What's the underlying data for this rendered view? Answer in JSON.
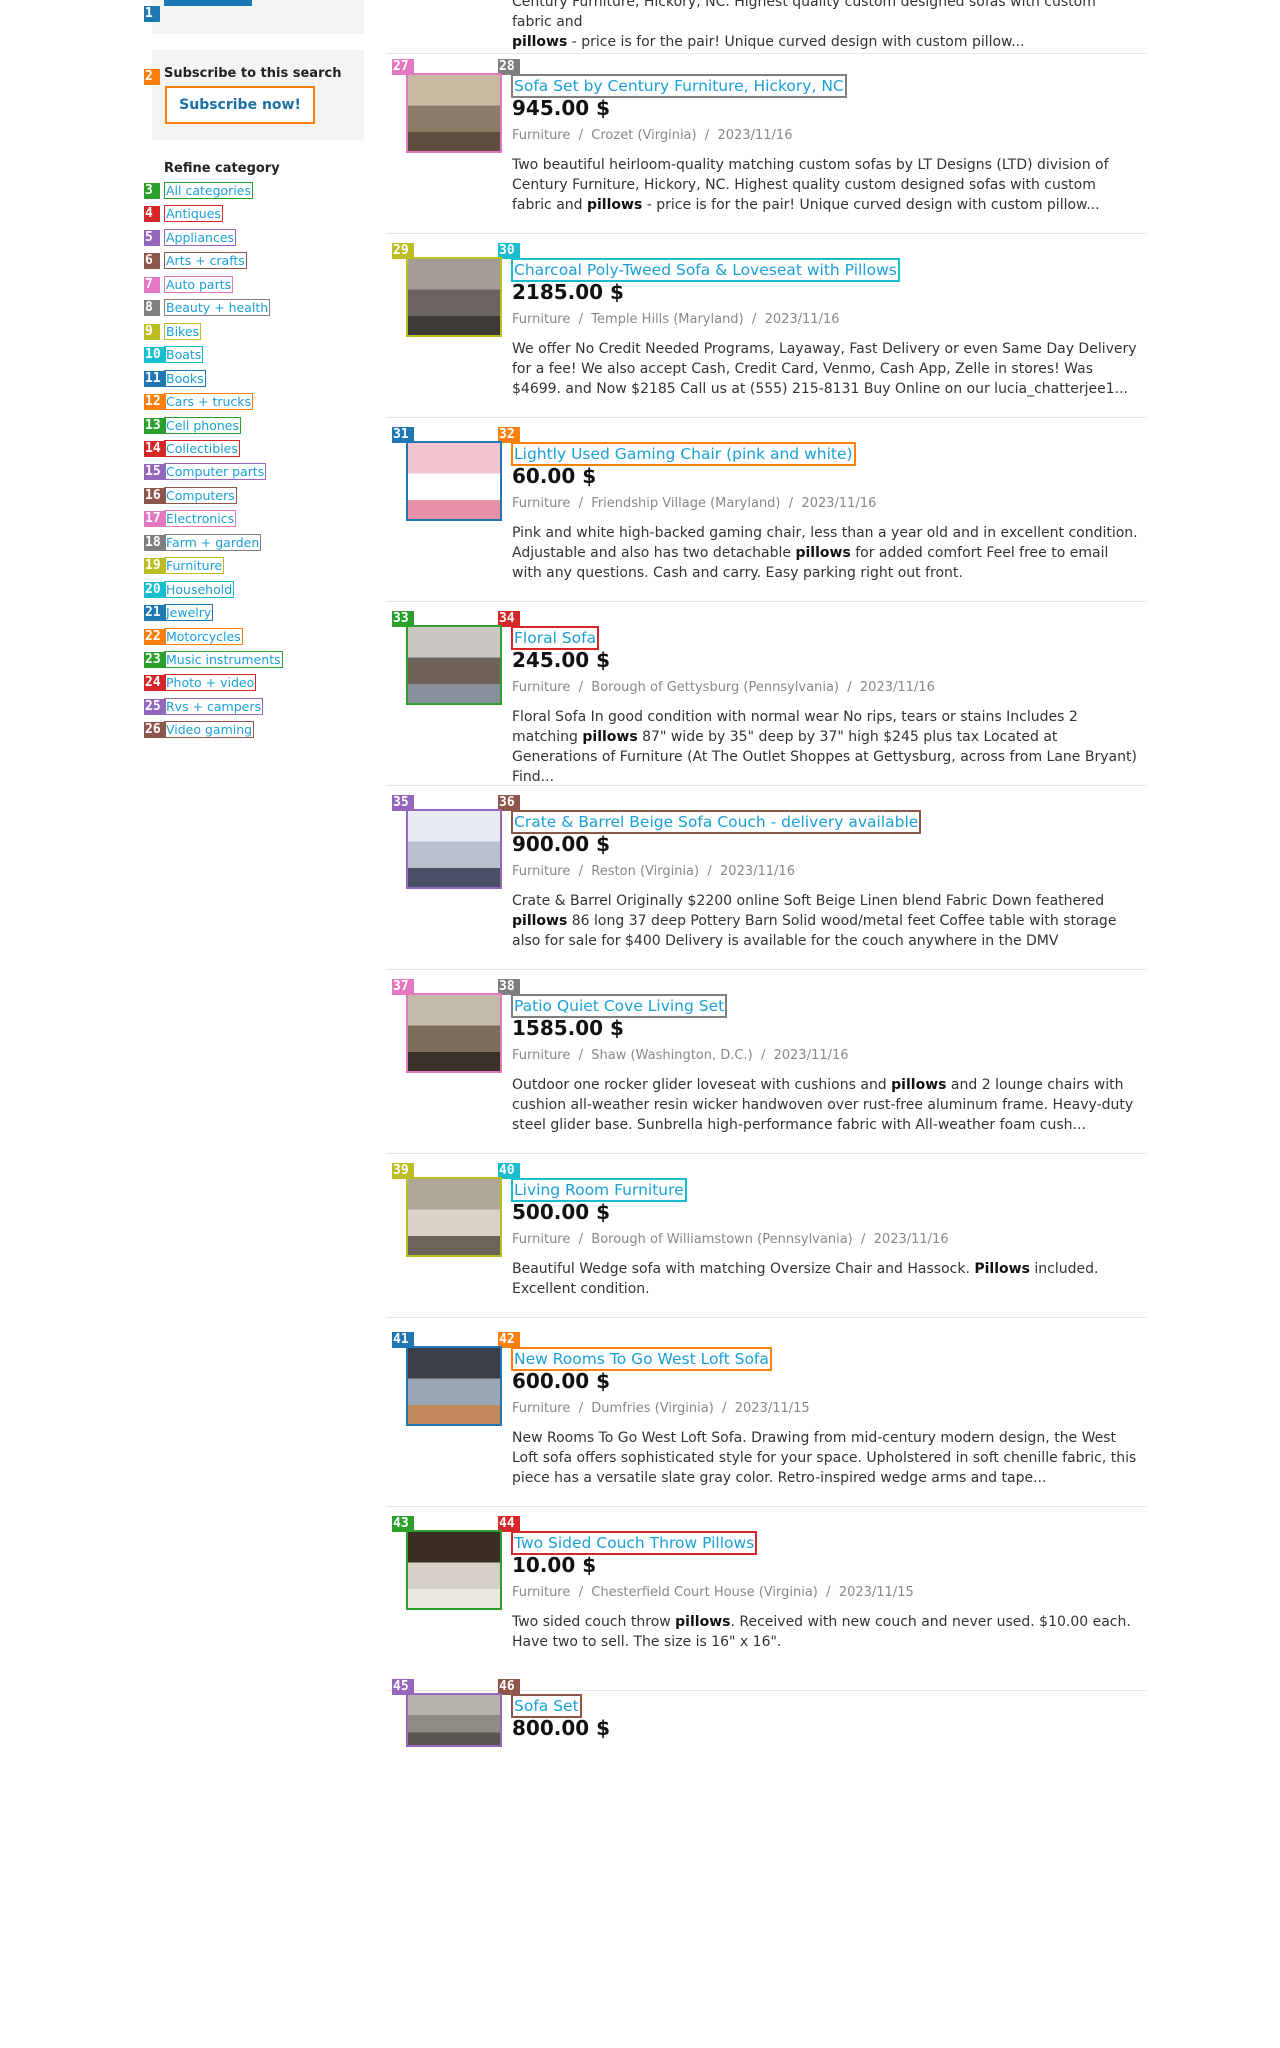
{
  "sidebar": {
    "subscribe_title": "Subscribe to this search",
    "subscribe_button": "Subscribe now!",
    "refine_title": "Refine category",
    "categories": [
      "All categories",
      "Antiques",
      "Appliances",
      "Arts + crafts",
      "Auto parts",
      "Beauty + health",
      "Bikes",
      "Boats",
      "Books",
      "Cars + trucks",
      "Cell phones",
      "Collectibles",
      "Computer parts",
      "Computers",
      "Electronics",
      "Farm + garden",
      "Furniture",
      "Household",
      "Jewelry",
      "Motorcycles",
      "Music instruments",
      "Photo + video",
      "Rvs + campers",
      "Video gaming"
    ]
  },
  "top_snippet": {
    "line1": "Century Furniture, Hickory, NC. Highest quality custom designed sofas with custom fabric and",
    "bold": "pillows",
    "line2": " - price is for the pair! Unique curved design with custom pillow..."
  },
  "listings": [
    {
      "title": "Sofa Set by Century Furniture, Hickory, NC",
      "price": "945.00 $",
      "category": "Furniture",
      "location": "Crozet (Virginia)",
      "date": "2023/11/16",
      "d1": "Two beautiful heirloom-quality matching custom sofas by LT Designs (LTD) division of Century Furniture, Hickory, NC. Highest quality custom designed sofas with custom fabric and ",
      "b": "pillows",
      "d2": " - price is for the pair! Unique curved design with custom pillow..."
    },
    {
      "title": "Charcoal Poly-Tweed Sofa & Loveseat with Pillows",
      "price": "2185.00 $",
      "category": "Furniture",
      "location": "Temple Hills (Maryland)",
      "date": "2023/11/16",
      "d1": "We offer No Credit Needed Programs, Layaway, Fast Delivery or even Same Day Delivery for a fee! We also accept Cash, Credit Card, Venmo, Cash App, Zelle in stores! Was $4699. and Now $2185 Call us at (555) 215-8131 Buy Online on our lucia_chatterjee1...",
      "b": "",
      "d2": ""
    },
    {
      "title": "Lightly Used Gaming Chair (pink and white)",
      "price": "60.00 $",
      "category": "Furniture",
      "location": "Friendship Village (Maryland)",
      "date": "2023/11/16",
      "d1": "Pink and white high-backed gaming chair, less than a year old and in excellent condition. Adjustable and also has two detachable ",
      "b": "pillows",
      "d2": " for added comfort Feel free to email with any questions. Cash and carry. Easy parking right out front."
    },
    {
      "title": "Floral Sofa",
      "price": "245.00 $",
      "category": "Furniture",
      "location": "Borough of Gettysburg (Pennsylvania)",
      "date": "2023/11/16",
      "d1": "Floral Sofa In good condition with normal wear No rips, tears or stains Includes 2 matching ",
      "b": "pillows",
      "d2": " 87\" wide by 35\" deep by 37\" high $245 plus tax Located at Generations of Furniture (At The Outlet Shoppes at Gettysburg, across from Lane Bryant) Find..."
    },
    {
      "title": "Crate & Barrel Beige Sofa Couch - delivery available",
      "price": "900.00 $",
      "category": "Furniture",
      "location": "Reston (Virginia)",
      "date": "2023/11/16",
      "d1": "Crate & Barrel Originally $2200 online Soft Beige Linen blend Fabric Down feathered ",
      "b": "pillows",
      "d2": " 86 long 37 deep Pottery Barn Solid wood/metal feet Coffee table with storage also for sale for $400 Delivery is available for the couch anywhere in the DMV"
    },
    {
      "title": "Patio Quiet Cove Living Set",
      "price": "1585.00 $",
      "category": "Furniture",
      "location": "Shaw (Washington, D.C.)",
      "date": "2023/11/16",
      "d1": "Outdoor one rocker glider loveseat with cushions and ",
      "b": "pillows",
      "d2": " and 2 lounge chairs with cushion all-weather resin wicker handwoven over rust-free aluminum frame. Heavy-duty steel glider base. Sunbrella high-performance fabric with All-weather foam cush..."
    },
    {
      "title": "Living Room Furniture",
      "price": "500.00 $",
      "category": "Furniture",
      "location": "Borough of Williamstown (Pennsylvania)",
      "date": "2023/11/16",
      "d1": "Beautiful Wedge sofa with matching Oversize Chair and Hassock. ",
      "b": "Pillows",
      "d2": " included. Excellent condition."
    },
    {
      "title": "New Rooms To Go West Loft Sofa",
      "price": "600.00 $",
      "category": "Furniture",
      "location": "Dumfries (Virginia)",
      "date": "2023/11/15",
      "d1": "New Rooms To Go West Loft Sofa. Drawing from mid-century modern design, the West Loft sofa offers sophisticated style for your space. Upholstered in soft chenille fabric, this piece has a versatile slate gray color. Retro-inspired wedge arms and tape...",
      "b": "",
      "d2": ""
    },
    {
      "title": "Two Sided Couch Throw Pillows",
      "price": "10.00 $",
      "category": "Furniture",
      "location": "Chesterfield Court House (Virginia)",
      "date": "2023/11/15",
      "d1": "Two sided couch throw ",
      "b": "pillows",
      "d2": ". Received with new couch and never used. $10.00 each. Have two to sell. The size is 16\" x 16\"."
    },
    {
      "title": "Sofa Set",
      "price": "800.00 $",
      "category": "",
      "location": "",
      "date": "",
      "d1": "",
      "b": "",
      "d2": ""
    }
  ],
  "colors": {
    "link": "#1a9fd8",
    "tag_palette": [
      "#1f77b4",
      "#ff7f0e",
      "#2ca02c",
      "#d62728",
      "#9467bd",
      "#8c564b",
      "#e377c2",
      "#7f7f7f",
      "#bcbd22",
      "#17becf"
    ]
  }
}
